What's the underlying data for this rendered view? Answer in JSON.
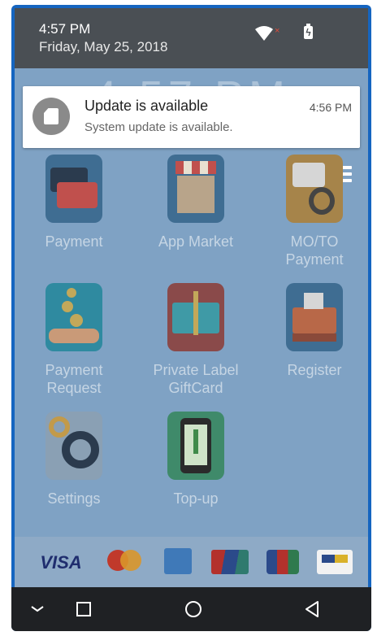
{
  "status_bar": {
    "time": "4:57 PM",
    "date": "Friday, May 25, 2018",
    "wifi_icon": "wifi-icon",
    "battery_icon": "battery-charging-icon"
  },
  "notification": {
    "title": "Update is available",
    "message": "System update is available.",
    "time": "4:56 PM",
    "icon": "system-update-icon"
  },
  "launcher": {
    "clock_text": "4:57 PM",
    "apps": [
      {
        "label": "Payment"
      },
      {
        "label": "App Market"
      },
      {
        "label": "MO/TO Payment"
      },
      {
        "label": "Payment Request"
      },
      {
        "label": "Private Label GiftCard"
      },
      {
        "label": "Register"
      },
      {
        "label": "Settings"
      },
      {
        "label": "Top-up"
      }
    ]
  },
  "card_logos": [
    "VISA",
    "mastercard",
    "AMERICAN EXPRESS",
    "UnionPay",
    "JCB",
    "Bancontact"
  ],
  "nav_bar": {
    "buttons": [
      "hide-keyboard",
      "recents",
      "home",
      "back"
    ]
  },
  "colors": {
    "device_frame": "#1565c0",
    "status_bar": "#4a4f54",
    "nav_bar": "#1f2124"
  }
}
